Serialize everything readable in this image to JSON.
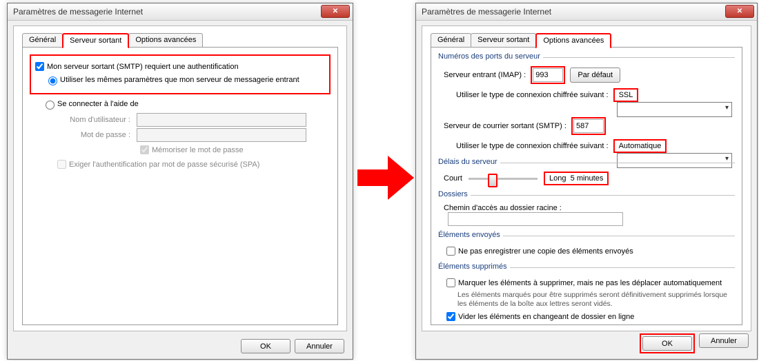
{
  "win1": {
    "title": "Paramètres de messagerie Internet",
    "tabs": {
      "general": "Général",
      "outgoing": "Serveur sortant",
      "advanced": "Options avancées"
    },
    "activeTab": "outgoing",
    "auth": {
      "chk_require": "Mon serveur sortant (SMTP) requiert une authentification",
      "rad_same": "Utiliser les mêmes paramètres que mon serveur de messagerie entrant",
      "rad_login": "Se connecter à l'aide de",
      "lbl_user": "Nom d'utilisateur :",
      "lbl_pass": "Mot de passe :",
      "chk_remember": "Mémoriser le mot de passe",
      "chk_spa": "Exiger l'authentification par mot de passe sécurisé (SPA)"
    }
  },
  "win2": {
    "title": "Paramètres de messagerie Internet",
    "tabs": {
      "general": "Général",
      "outgoing": "Serveur sortant",
      "advanced": "Options avancées"
    },
    "activeTab": "advanced",
    "ports": {
      "legend": "Numéros des ports du serveur",
      "lbl_in": "Serveur entrant (IMAP) :",
      "port_in": "993",
      "btn_default": "Par défaut",
      "lbl_enc_in": "Utiliser le type de connexion chiffrée suivant :",
      "enc_in": "SSL",
      "lbl_out": "Serveur de courrier sortant (SMTP) :",
      "port_out": "587",
      "lbl_enc_out": "Utiliser le type de connexion chiffrée suivant :",
      "enc_out": "Automatique"
    },
    "timeout": {
      "legend": "Délais du serveur",
      "short": "Court",
      "long": "Long",
      "value": "5 minutes"
    },
    "folders": {
      "legend": "Dossiers",
      "lbl_root": "Chemin d'accès au dossier racine :"
    },
    "sent": {
      "legend": "Éléments envoyés",
      "chk_nosave": "Ne pas enregistrer une copie des éléments envoyés"
    },
    "deleted": {
      "legend": "Éléments supprimés",
      "chk_mark": "Marquer les éléments à supprimer, mais ne pas les déplacer automatiquement",
      "desc": "Les éléments marqués pour être supprimés seront définitivement supprimés lorsque les éléments de la boîte aux lettres seront vidés.",
      "chk_purge": "Vider les éléments en changeant de dossier en ligne"
    }
  },
  "buttons": {
    "ok": "OK",
    "cancel": "Annuler"
  }
}
